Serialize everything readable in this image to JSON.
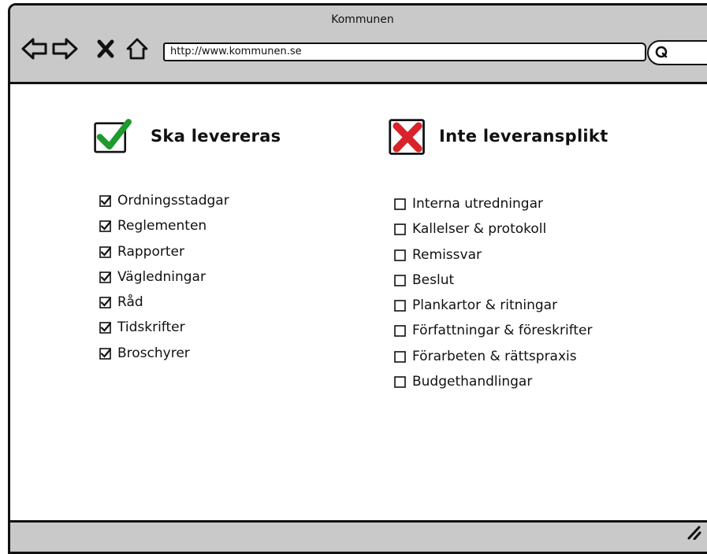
{
  "window": {
    "title": "Kommunen"
  },
  "toolbar": {
    "back_icon": "back-arrow-icon",
    "forward_icon": "forward-arrow-icon",
    "stop_icon": "close-icon",
    "home_icon": "home-icon",
    "url": "http://www.kommunen.se",
    "search_icon": "search-icon"
  },
  "columns": [
    {
      "icon": "checkmark-icon",
      "title": "Ska levereras",
      "checked": true,
      "items": [
        {
          "label": "Ordningsstadgar"
        },
        {
          "label": "Reglementen"
        },
        {
          "label": "Rapporter"
        },
        {
          "label": "Vägledningar"
        },
        {
          "label": "Råd"
        },
        {
          "label": "Tidskrifter"
        },
        {
          "label": "Broschyrer"
        }
      ]
    },
    {
      "icon": "red-x-icon",
      "title": "Inte leveransplikt",
      "checked": false,
      "items": [
        {
          "label": "Interna utredningar"
        },
        {
          "label": "Kallelser & protokoll"
        },
        {
          "label": "Remissvar"
        },
        {
          "label": "Beslut"
        },
        {
          "label": "Plankartor & ritningar"
        },
        {
          "label": "Författningar & föreskrifter"
        },
        {
          "label": "Förarbeten & rättspraxis"
        },
        {
          "label": "Budgethandlingar"
        }
      ]
    }
  ],
  "colors": {
    "chrome": "#c9c9c9",
    "check_green": "#1e9a2e",
    "x_red": "#d8232a"
  }
}
